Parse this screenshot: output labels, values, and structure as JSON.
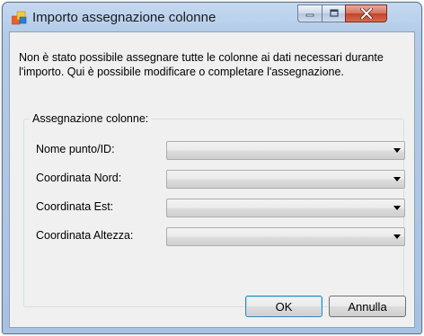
{
  "window": {
    "title": "Importo assegnazione colonne"
  },
  "message": "Non è stato possibile assegnare tutte le colonne ai dati necessari durante l'importo. Qui è possibile modificare o completare l'assegnazione.",
  "group": {
    "legend": "Assegnazione colonne:",
    "fields": [
      {
        "label": "Nome punto/ID:",
        "value": ""
      },
      {
        "label": "Coordinata  Nord:",
        "value": ""
      },
      {
        "label": "Coordinata  Est:",
        "value": ""
      },
      {
        "label": "Coordinata Altezza:",
        "value": ""
      }
    ]
  },
  "buttons": {
    "ok": "OK",
    "cancel": "Annulla"
  },
  "icons": {
    "app": "app-icon",
    "minimize": "minimize-icon",
    "maximize": "maximize-icon",
    "close": "close-icon",
    "dropdown": "chevron-down-icon"
  }
}
